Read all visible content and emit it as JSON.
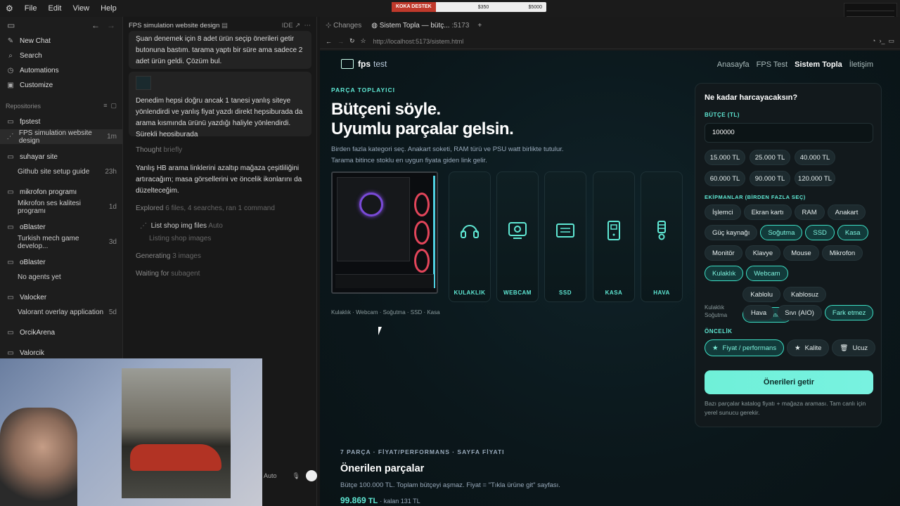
{
  "menu": {
    "file": "File",
    "edit": "Edit",
    "view": "View",
    "help": "Help"
  },
  "overlay": {
    "label": "KOKA DESTEK",
    "amount1": "$350",
    "amount2": "$5000"
  },
  "sidebar": {
    "new_chat": "New Chat",
    "search": "Search",
    "automations": "Automations",
    "customize": "Customize",
    "repos_label": "Repositories",
    "repos": [
      {
        "name": "fpstest",
        "items": [
          {
            "label": "FPS simulation website design",
            "time": "1m"
          }
        ]
      },
      {
        "name": "suhayar site",
        "items": [
          {
            "label": "Github site setup guide",
            "time": "23h"
          }
        ]
      },
      {
        "name": "mikrofon programı",
        "items": [
          {
            "label": "Mikrofon ses kalitesi programı",
            "time": "1d"
          }
        ]
      },
      {
        "name": "oBlaster",
        "items": [
          {
            "label": "Turkish mech game develop...",
            "time": "3d"
          }
        ]
      },
      {
        "name": "oBlaster",
        "items": [
          {
            "label": "No agents yet",
            "time": ""
          }
        ]
      },
      {
        "name": "Valocker",
        "items": [
          {
            "label": "Valorant overlay application",
            "time": "5d"
          }
        ]
      },
      {
        "name": "OrcikArena",
        "items": []
      },
      {
        "name": "Valorcik",
        "items": []
      }
    ]
  },
  "chat": {
    "title": "FPS simulation website design",
    "ide": "IDE",
    "msg1": "Şuan denemek için 8 adet ürün seçip önerileri getir butonuna bastım. tarama yaptı bir süre ama sadece 2 adet ürün geldi. Çözüm bul.",
    "msg2": "Denedim hepsi doğru ancak 1 tanesi yanlış siteye yönlendirdi ve yanlış fiyat yazdı direkt hepsiburada da arama kısmında ürünü yazdığı haliyle yönlendirdi. Sürekli hepsiburada",
    "thought": "Thought",
    "thought_sub": "briefly",
    "reply": "Yanlış HB arama linklerini azaltıp mağaza çeşitliliğini artıracağım; masa görsellerini ve öncelik ikonlarını da düzelteceğim.",
    "explored": "Explored",
    "explored_sub": "6 files, 4 searches, ran 1 command",
    "list_shop": "List shop img files",
    "list_shop_sub": "Auto",
    "listing": "Listing shop images",
    "generating": "Generating",
    "generating_sub": "3 images",
    "waiting": "Waiting for",
    "waiting_sub": "subagent",
    "mode": "Auto"
  },
  "browser": {
    "changes": "Changes",
    "tab": "Sistem Topla — bütç...",
    "port": ":5173",
    "url": "http://localhost:5173/sistem.html"
  },
  "site": {
    "logo_a": "fps",
    "logo_b": "test",
    "nav": [
      "Anasayfa",
      "FPS Test",
      "Sistem Topla",
      "İletişim"
    ],
    "kicker": "PARÇA TOPLAYICI",
    "h1a": "Bütçeni söyle.",
    "h1b": "Uyumlu parçalar gelsin.",
    "desc1": "Birden fazla kategori seç. Anakart soketi, RAM türü ve PSU watt birlikte tutulur.",
    "desc2": "Tarama bitince stoklu en uygun fiyata giden link gelir.",
    "cards": [
      "KULAKLIK",
      "WEBCAM",
      "SSD",
      "KASA",
      "HAVA"
    ],
    "selected_line": "Kulaklık · Webcam · Soğutma · SSD · Kasa",
    "panel": {
      "title": "Ne kadar harcayacaksın?",
      "budget_label": "BÜTÇE (TL)",
      "budget_value": "100000",
      "presets": [
        "15.000 TL",
        "25.000 TL",
        "40.000 TL",
        "60.000 TL",
        "90.000 TL",
        "120.000 TL"
      ],
      "equip_label": "EKİPMANLAR (BİRDEN FAZLA SEÇ)",
      "equip": [
        "İşlemci",
        "Ekran kartı",
        "RAM",
        "Anakart",
        "Güç kaynağı",
        "Soğutma",
        "SSD",
        "Kasa",
        "Monitör",
        "Klavye",
        "Mouse",
        "Mikrofon",
        "Kulaklık",
        "Webcam"
      ],
      "equip_selected": [
        "Soğutma",
        "SSD",
        "Kasa",
        "Kulaklık",
        "Webcam"
      ],
      "kulaklik_label": "Kulaklık",
      "kulaklik_opts": [
        "Kablolu",
        "Kablosuz",
        "Fark etmez"
      ],
      "sogutma_label": "Soğutma",
      "sogutma_opts": [
        "Hava",
        "Sıvı (AIO)",
        "Fark etmez"
      ],
      "priority_label": "ÖNCELİK",
      "priority": [
        "Fiyat / performans",
        "Kalite",
        "Ucuz"
      ],
      "cta": "Önerileri getir",
      "note": "Bazı parçalar katalog fiyatı + mağaza araması. Tam canlı için yerel sunucu gerekir."
    },
    "results": {
      "kicker": "7 PARÇA · FİYAT/PERFORMANS · SAYFA FİYATI",
      "title": "Önerilen parçalar",
      "sub": "Bütçe 100.000 TL. Toplam bütçeyi aşmaz. Fiyat = \"Tıkla ürüne git\" sayfası.",
      "total": "99.869",
      "currency": "TL",
      "remaining": "· kalan 131 TL"
    }
  },
  "colors": {
    "accent": "#5fe8d4",
    "cta": "#6ff0d8",
    "bg": "#0b171b"
  }
}
